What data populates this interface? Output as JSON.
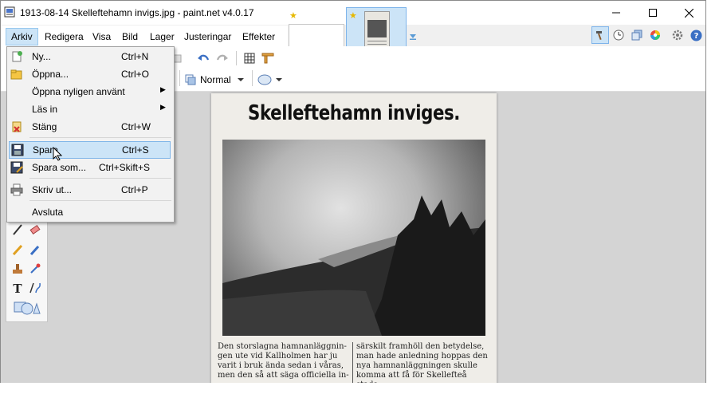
{
  "window": {
    "title": "1913-08-14 Skelleftehamn invigs.jpg - paint.net v4.0.17",
    "minimize_icon": "minimize-icon",
    "maximize_icon": "maximize-icon",
    "close_icon": "close-icon"
  },
  "menubar": {
    "items": [
      {
        "label": "Arkiv"
      },
      {
        "label": "Redigera"
      },
      {
        "label": "Visa"
      },
      {
        "label": "Bild"
      },
      {
        "label": "Lager"
      },
      {
        "label": "Justeringar"
      },
      {
        "label": "Effekter"
      }
    ]
  },
  "toolbar": {
    "blend_mode": "Normal"
  },
  "file_menu": {
    "items": [
      {
        "label": "Ny...",
        "shortcut": "Ctrl+N",
        "icon": "new-file-icon"
      },
      {
        "label": "Öppna...",
        "shortcut": "Ctrl+O",
        "icon": "open-folder-icon"
      },
      {
        "label": "Öppna nyligen använt",
        "shortcut": "",
        "icon": ""
      },
      {
        "label": "Läs in",
        "shortcut": "",
        "icon": ""
      },
      {
        "label": "Stäng",
        "shortcut": "Ctrl+W",
        "icon": "close-document-icon"
      },
      {
        "label": "Spara",
        "shortcut": "Ctrl+S",
        "icon": "save-icon"
      },
      {
        "label": "Spara som...",
        "shortcut": "Ctrl+Skift+S",
        "icon": "save-as-icon"
      },
      {
        "label": "Skriv ut...",
        "shortcut": "Ctrl+P",
        "icon": "print-icon"
      },
      {
        "label": "Avsluta",
        "shortcut": "",
        "icon": ""
      }
    ],
    "hovered": "Spara"
  },
  "document": {
    "headline": "Skelleftehamn inviges.",
    "article_left": "Den storslagna hamnanläggnin-\ngen ute vid Kallholmen har ju\nvarit i bruk ända sedan i våras,\nmen den så att säga officiella in-",
    "article_right": "särskilt framhöll den betydelse,\nman hade anledning hoppas den\nnya hamnanläggningen skulle\nkomma att få för Skellefteå stads"
  },
  "colors": {
    "accent": "#cce4f7",
    "accent_border": "#7eb4ea",
    "canvas_bg": "#d4d4d4"
  }
}
